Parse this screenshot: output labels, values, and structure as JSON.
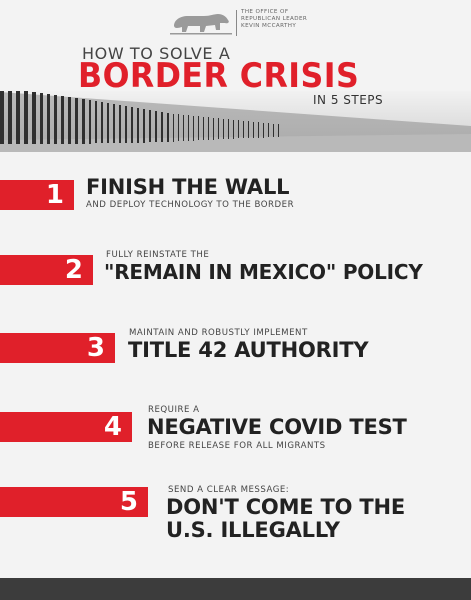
{
  "header": {
    "org_lines": [
      "THE OFFICE OF",
      "REPUBLICAN LEADER",
      "KEVIN MCCARTHY"
    ],
    "how_to": "HOW TO SOLVE A",
    "title": "BORDER CRISIS",
    "subtitle": "IN 5 STEPS"
  },
  "steps": [
    {
      "number": "1",
      "headline": "FINISH THE WALL",
      "below": "AND DEPLOY TECHNOLOGY TO THE BORDER"
    },
    {
      "number": "2",
      "above": "FULLY REINSTATE THE",
      "headline": "\"REMAIN IN MEXICO\" POLICY"
    },
    {
      "number": "3",
      "above": "MAINTAIN AND ROBUSTLY IMPLEMENT",
      "headline": "TITLE 42 AUTHORITY"
    },
    {
      "number": "4",
      "above": "REQUIRE A",
      "headline": "NEGATIVE COVID TEST",
      "below": "BEFORE RELEASE FOR ALL MIGRANTS"
    },
    {
      "number": "5",
      "above": "SEND A CLEAR MESSAGE:",
      "headline_lines": [
        "DON'T COME TO THE",
        "U.S. ILLEGALLY"
      ]
    }
  ],
  "colors": {
    "accent": "#e0202a",
    "text": "#222222",
    "footer": "#3c3c3c"
  },
  "icons": {
    "logo": "bear-icon"
  }
}
